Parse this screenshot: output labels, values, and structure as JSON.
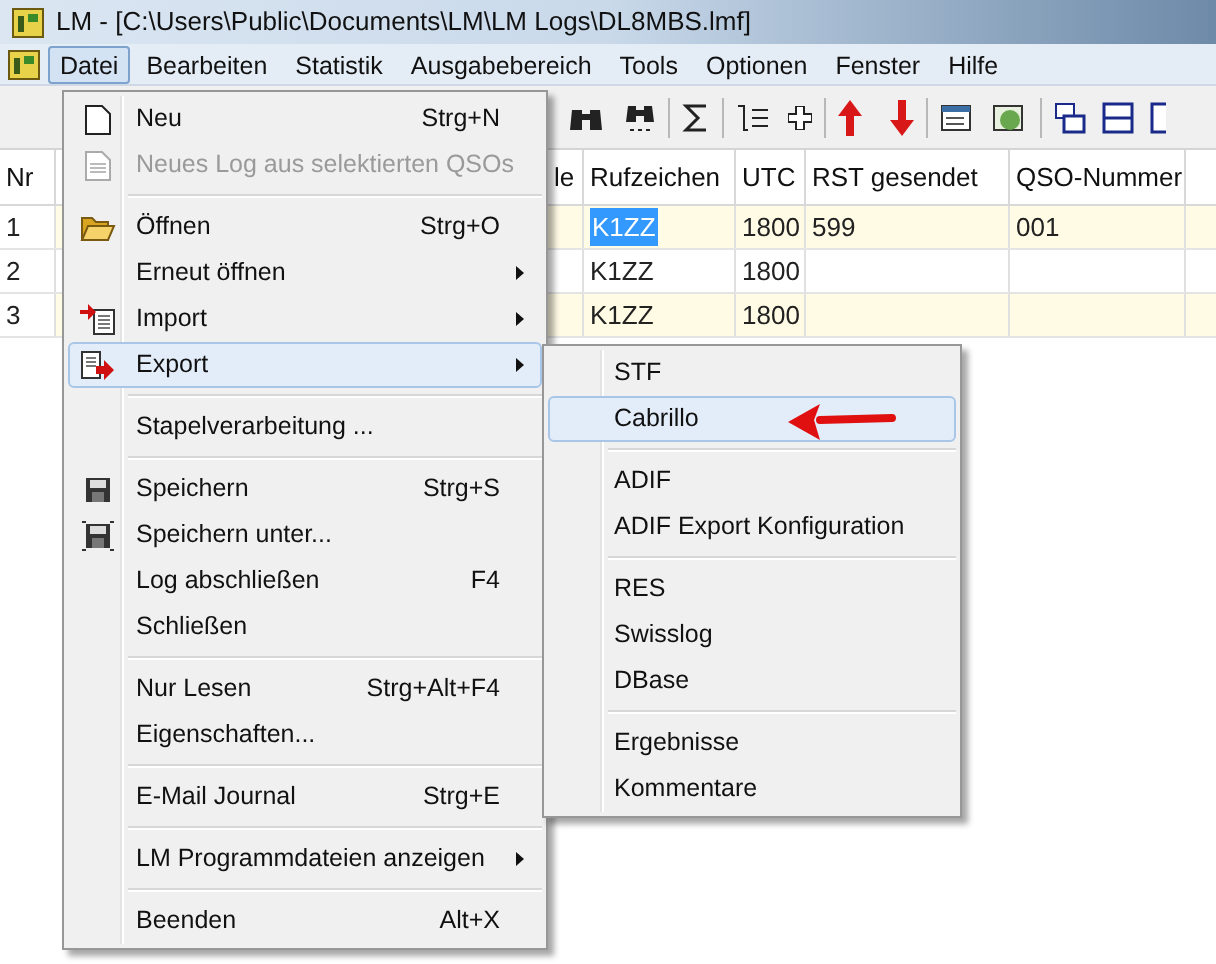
{
  "window": {
    "title": "LM - [C:\\Users\\Public\\Documents\\LM\\LM Logs\\DL8MBS.lmf]"
  },
  "menu_bar": [
    {
      "label": "Datei",
      "selected": true
    },
    {
      "label": "Bearbeiten",
      "selected": false
    },
    {
      "label": "Statistik",
      "selected": false
    },
    {
      "label": "Ausgabebereich",
      "selected": false
    },
    {
      "label": "Tools",
      "selected": false
    },
    {
      "label": "Optionen",
      "selected": false
    },
    {
      "label": "Fenster",
      "selected": false
    },
    {
      "label": "Hilfe",
      "selected": false
    }
  ],
  "table": {
    "columns": [
      "Nr",
      "le",
      "Rufzeichen",
      "UTC",
      "RST gesendet",
      "QSO-Nummer"
    ],
    "rows": [
      {
        "cells": [
          "1",
          null,
          "K1ZZ",
          "1800",
          "599",
          "001"
        ],
        "selected": true
      },
      {
        "cells": [
          "2",
          null,
          "K1ZZ",
          "1800"
        ],
        "selected": false
      },
      {
        "cells": [
          "3",
          null,
          "K1ZZ",
          "1800"
        ],
        "selected": false
      }
    ]
  },
  "file_menu": [
    {
      "kind": "item",
      "label": "Neu",
      "shortcut": "Strg+N",
      "submenu": false,
      "disabled": false,
      "selected": false
    },
    {
      "kind": "item",
      "label": "Neues Log aus selektierten QSOs",
      "submenu": false,
      "disabled": true,
      "selected": false
    },
    {
      "kind": "separator"
    },
    {
      "kind": "item",
      "label": "Öffnen",
      "shortcut": "Strg+O",
      "submenu": false,
      "disabled": false,
      "selected": false
    },
    {
      "kind": "item",
      "label": "Erneut öffnen",
      "submenu": true,
      "disabled": false,
      "selected": false
    },
    {
      "kind": "item",
      "label": "Import",
      "submenu": true,
      "disabled": false,
      "selected": false
    },
    {
      "kind": "item",
      "label": "Export",
      "submenu": true,
      "disabled": false,
      "selected": true
    },
    {
      "kind": "separator"
    },
    {
      "kind": "item",
      "label": "Stapelverarbeitung ...",
      "submenu": false,
      "disabled": false,
      "selected": false
    },
    {
      "kind": "separator"
    },
    {
      "kind": "item",
      "label": "Speichern",
      "shortcut": "Strg+S",
      "submenu": false,
      "disabled": false,
      "selected": false
    },
    {
      "kind": "item",
      "label": "Speichern unter...",
      "submenu": false,
      "disabled": false,
      "selected": false
    },
    {
      "kind": "item",
      "label": "Log abschließen",
      "shortcut": "F4",
      "submenu": false,
      "disabled": false,
      "selected": false
    },
    {
      "kind": "item",
      "label": "Schließen",
      "submenu": false,
      "disabled": false,
      "selected": false
    },
    {
      "kind": "separator"
    },
    {
      "kind": "item",
      "label": "Nur Lesen",
      "shortcut": "Strg+Alt+F4",
      "submenu": false,
      "disabled": false,
      "selected": false
    },
    {
      "kind": "item",
      "label": "Eigenschaften...",
      "submenu": false,
      "disabled": false,
      "selected": false
    },
    {
      "kind": "separator"
    },
    {
      "kind": "item",
      "label": "E-Mail Journal",
      "shortcut": "Strg+E",
      "submenu": false,
      "disabled": false,
      "selected": false
    },
    {
      "kind": "separator"
    },
    {
      "kind": "item",
      "label": "LM Programmdateien anzeigen",
      "submenu": true,
      "disabled": false,
      "selected": false
    },
    {
      "kind": "separator"
    },
    {
      "kind": "item",
      "label": "Beenden",
      "shortcut": "Alt+X",
      "submenu": false,
      "disabled": false,
      "selected": false
    }
  ],
  "export_submenu": [
    {
      "kind": "item",
      "label": "STF",
      "selected": false
    },
    {
      "kind": "item",
      "label": "Cabrillo",
      "selected": true
    },
    {
      "kind": "separator"
    },
    {
      "kind": "item",
      "label": "ADIF",
      "selected": false
    },
    {
      "kind": "item",
      "label": "ADIF Export Konfiguration",
      "selected": false
    },
    {
      "kind": "separator"
    },
    {
      "kind": "item",
      "label": "RES",
      "selected": false
    },
    {
      "kind": "item",
      "label": "Swisslog",
      "selected": false
    },
    {
      "kind": "item",
      "label": "DBase",
      "selected": false
    },
    {
      "kind": "separator"
    },
    {
      "kind": "item",
      "label": "Ergebnisse",
      "selected": false
    },
    {
      "kind": "item",
      "label": "Kommentare",
      "selected": false
    }
  ]
}
